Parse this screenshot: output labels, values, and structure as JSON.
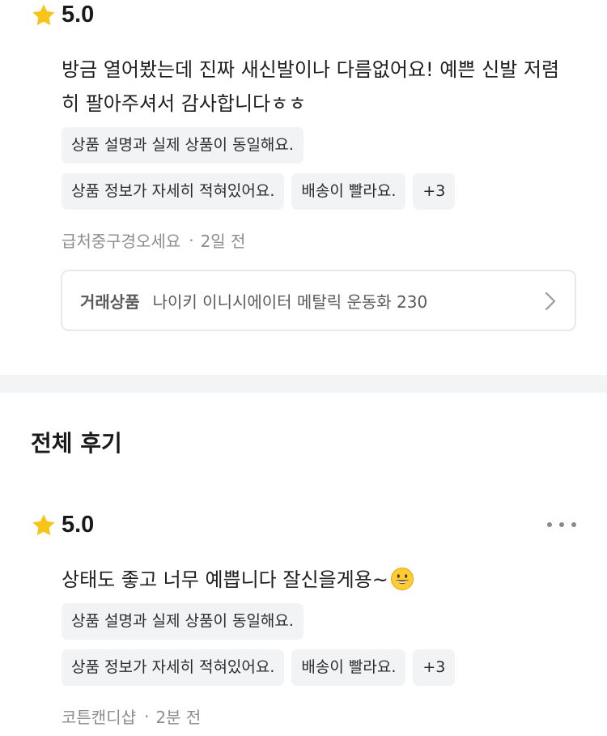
{
  "review1": {
    "score": "5.0",
    "text_line1": "방금 열어봤는데 진짜 새신발이나 다름없어요! 예쁜 신발 저렴",
    "text_line2": "히 팔아주셔서 감사합니다ㅎㅎ",
    "tags": [
      "상품 설명과 실제 상품이 동일해요.",
      "상품 정보가 자세히 적혀있어요.",
      "배송이 빨라요.",
      "+3"
    ],
    "author": "급처중구경오세요",
    "time": "2일 전",
    "product_label": "거래상품",
    "product_name": "나이키 이니시에이터 메탈릭 운동화 230"
  },
  "section": {
    "title": "전체 후기"
  },
  "review2": {
    "score": "5.0",
    "text": "상태도 좋고 너무 예쁩니다 잘신을게용~",
    "emoji": "grinning-face-emoji",
    "tags": [
      "상품 설명과 실제 상품이 동일해요.",
      "상품 정보가 자세히 적혀있어요.",
      "배송이 빨라요.",
      "+3"
    ],
    "author": "코튼캔디샵",
    "time": "2분 전"
  },
  "icons": {
    "star": "star-icon",
    "more": "more-dots-icon",
    "chevron": "chevron-right-icon"
  },
  "colors": {
    "star": "#F7C417",
    "tag_bg": "#F2F3F5",
    "meta_text": "#8C8C8C",
    "divider": "#F3F4F6"
  }
}
